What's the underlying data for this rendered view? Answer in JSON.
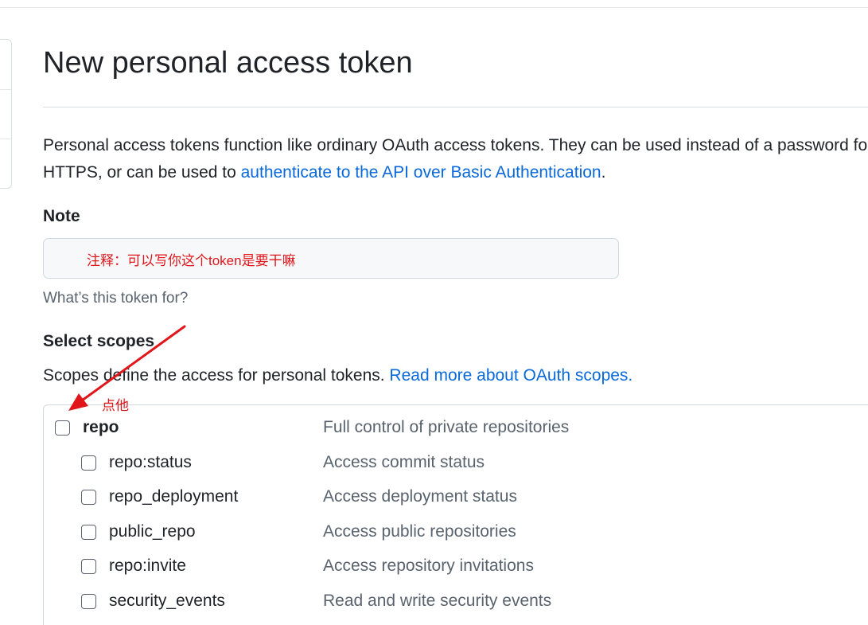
{
  "page": {
    "title": "New personal access token"
  },
  "intro": {
    "line1": "Personal access tokens function like ordinary OAuth access tokens. They can be used instead of a password for Git over",
    "line2_before": "HTTPS, or can be used to ",
    "link": "authenticate to the API over Basic Authentication",
    "line2_after": "."
  },
  "note": {
    "label": "Note",
    "value": "",
    "hint": "What’s this token for?"
  },
  "scopes": {
    "label": "Select scopes",
    "desc_before": "Scopes define the access for personal tokens. ",
    "desc_link": "Read more about OAuth scopes.",
    "items": [
      {
        "name": "repo",
        "desc": "Full control of private repositories",
        "checked": false,
        "parent": true
      },
      {
        "name": "repo:status",
        "desc": "Access commit status",
        "checked": false,
        "parent": false
      },
      {
        "name": "repo_deployment",
        "desc": "Access deployment status",
        "checked": false,
        "parent": false
      },
      {
        "name": "public_repo",
        "desc": "Access public repositories",
        "checked": false,
        "parent": false
      },
      {
        "name": "repo:invite",
        "desc": "Access repository invitations",
        "checked": false,
        "parent": false
      },
      {
        "name": "security_events",
        "desc": "Read and write security events",
        "checked": false,
        "parent": false
      }
    ]
  },
  "annotations": {
    "note_text": "注释：可以写你这个token是要干嘛",
    "click_text": "点他",
    "color": "#e0161b"
  },
  "colors": {
    "link": "#0969da",
    "text": "#1f2328",
    "muted": "#59636e",
    "border": "#d0d7de"
  }
}
